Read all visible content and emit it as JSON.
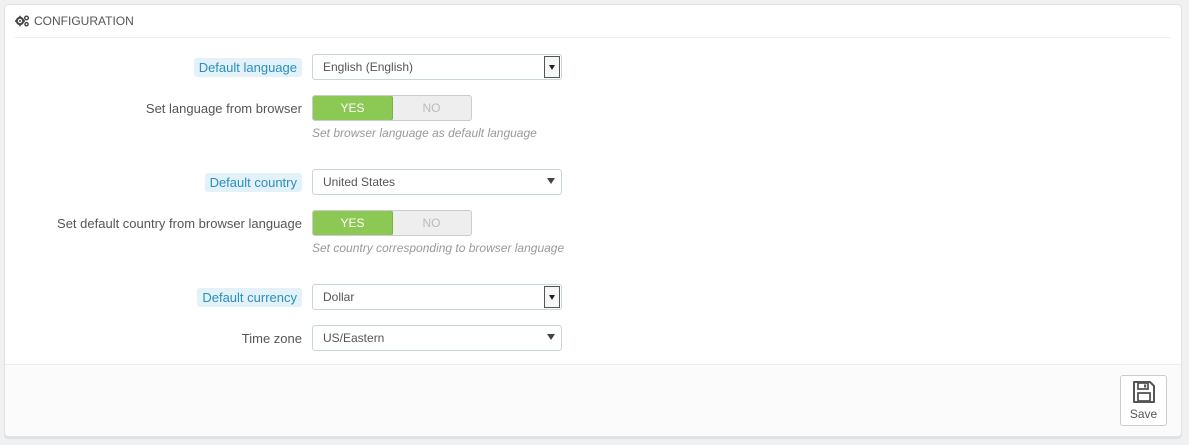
{
  "panel": {
    "heading": "Configuration"
  },
  "form": {
    "default_language": {
      "label": "Default language",
      "value": "English (English)"
    },
    "browser_language": {
      "label": "Set language from browser",
      "yes": "YES",
      "no": "NO",
      "selected": "YES",
      "help": "Set browser language as default language"
    },
    "default_country": {
      "label": "Default country",
      "value": "United States"
    },
    "browser_country": {
      "label": "Set default country from browser language",
      "yes": "YES",
      "no": "NO",
      "selected": "YES",
      "help": "Set country corresponding to browser language"
    },
    "default_currency": {
      "label": "Default currency",
      "value": "Dollar"
    },
    "time_zone": {
      "label": "Time zone",
      "value": "US/Eastern"
    }
  },
  "footer": {
    "save_label": "Save"
  },
  "colors": {
    "toggle_on": "#8bc954",
    "label_tip_bg": "#e3f1f9",
    "label_tip_text": "#2a8fbd"
  },
  "icons": {
    "heading": "cogs-icon",
    "save": "floppy-disk-icon"
  }
}
